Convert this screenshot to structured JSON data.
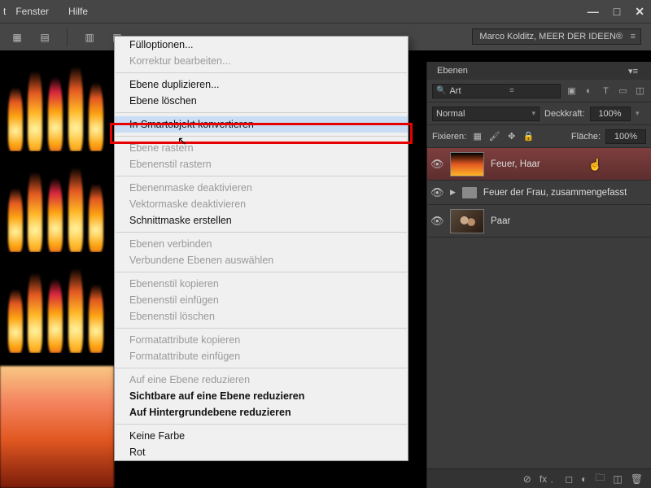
{
  "menubar": {
    "item_window": "Fenster",
    "item_help": "Hilfe",
    "fragment": "t"
  },
  "window_controls": {
    "minimize": "—",
    "maximize": "□",
    "close": "✕"
  },
  "doc_title": "Marco Kolditz, MEER DER IDEEN®",
  "context_menu": {
    "fill_options": "Fülloptionen...",
    "edit_correction": "Korrektur bearbeiten...",
    "duplicate_layer": "Ebene duplizieren...",
    "delete_layer": "Ebene löschen",
    "convert_smart": "In Smartobjekt konvertieren",
    "rasterize_layer": "Ebene rastern",
    "rasterize_style": "Ebenenstil rastern",
    "disable_mask": "Ebenenmaske deaktivieren",
    "disable_vector": "Vektormaske deaktivieren",
    "create_clipmask": "Schnittmaske erstellen",
    "link_layers": "Ebenen verbinden",
    "select_linked": "Verbundene Ebenen auswählen",
    "copy_style": "Ebenenstil kopieren",
    "paste_style": "Ebenenstil einfügen",
    "delete_style": "Ebenenstil löschen",
    "copy_format": "Formatattribute kopieren",
    "paste_format": "Formatattribute einfügen",
    "flatten_one": "Auf eine Ebene reduzieren",
    "flatten_visible": "Sichtbare auf eine Ebene reduzieren",
    "flatten_bg": "Auf Hintergrundebene reduzieren",
    "no_color": "Keine Farbe",
    "red": "Rot"
  },
  "layers_panel": {
    "title": "Ebenen",
    "search_type": "Art",
    "blend_mode": "Normal",
    "opacity_label": "Deckkraft:",
    "opacity_value": "100%",
    "lock_label": "Fixieren:",
    "fill_label": "Fläche:",
    "fill_value": "100%",
    "layers": [
      {
        "name": "Feuer, Haar"
      },
      {
        "name": "Feuer der Frau, zusammengefasst"
      },
      {
        "name": "Paar"
      }
    ]
  }
}
